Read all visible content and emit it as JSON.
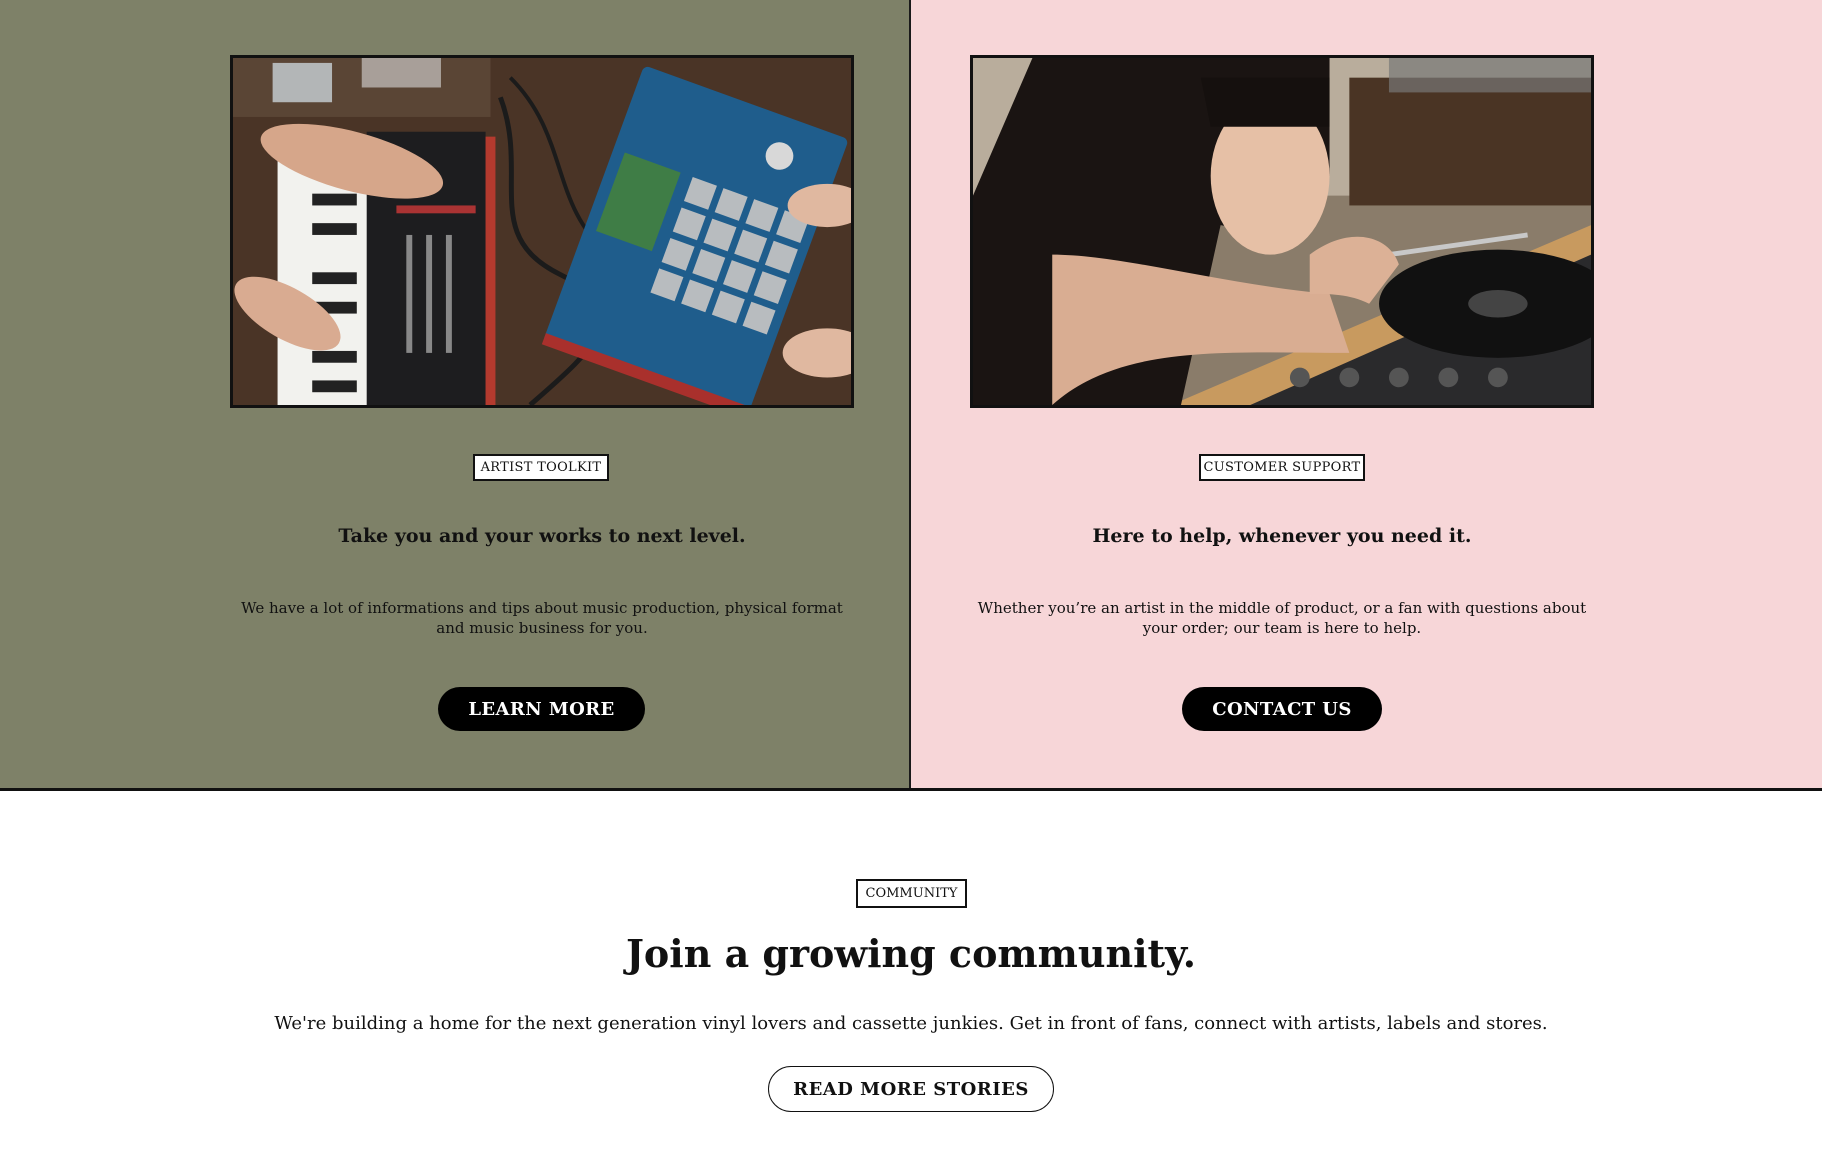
{
  "toolkit": {
    "tag": "ARTIST TOOLKIT",
    "heading": "Take you and your works to next level.",
    "body": "We have a lot of informations and tips about music production, physical format and music business for you.",
    "button": "LEARN MORE",
    "bg_color": "#7e8168"
  },
  "support": {
    "tag": "CUSTOMER SUPPORT",
    "heading": "Here to help, whenever you need it.",
    "body": "Whether you’re an artist in the middle of product, or a fan with questions about your order; our team is here to help.",
    "button": "CONTACT US",
    "bg_color": "#f7d6d8"
  },
  "community": {
    "tag": "COMMUNITY",
    "title": "Join a growing community.",
    "text": "We're building a home for the next generation vinyl lovers and cassette junkies. Get in front of fans, connect with artists, labels and stores.",
    "button": "READ MORE STORIES"
  }
}
